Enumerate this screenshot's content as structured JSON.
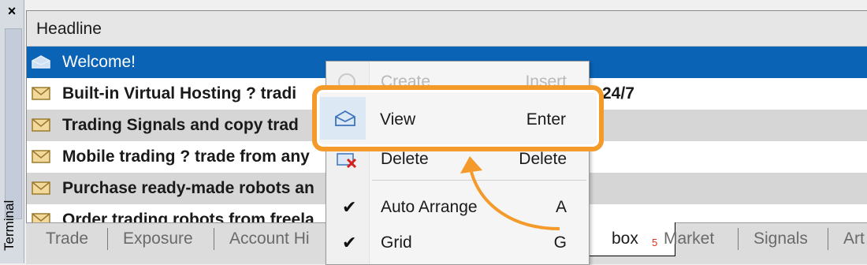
{
  "side": {
    "close": "×",
    "label": "Terminal"
  },
  "header": {
    "label": "Headline"
  },
  "rows": [
    {
      "text": "Welcome!",
      "tail": ""
    },
    {
      "text": "Built-in Virtual Hosting ? tradi",
      "tail": "24/7"
    },
    {
      "text": "Trading Signals and copy trad",
      "tail": ""
    },
    {
      "text": "Mobile trading ? trade from any",
      "tail": ""
    },
    {
      "text": "Purchase ready-made robots an",
      "tail": ""
    },
    {
      "text": "Order trading robots from freela",
      "tail": ""
    }
  ],
  "tabs": {
    "trade": "Trade",
    "exposure": "Exposure",
    "account": "Account Hi",
    "inbox": "box",
    "inbox_badge": "5",
    "market": "Market",
    "signals": "Signals",
    "articles": "Art"
  },
  "menu": {
    "create": {
      "label": "Create",
      "shortcut": "Insert"
    },
    "view": {
      "label": "View",
      "shortcut": "Enter"
    },
    "delete": {
      "label": "Delete",
      "shortcut": "Delete"
    },
    "auto_arrange": {
      "label": "Auto Arrange",
      "shortcut": "A"
    },
    "grid": {
      "label": "Grid",
      "shortcut": "G"
    }
  },
  "colors": {
    "selection": "#0a63b5",
    "highlight": "#f39a2b"
  }
}
